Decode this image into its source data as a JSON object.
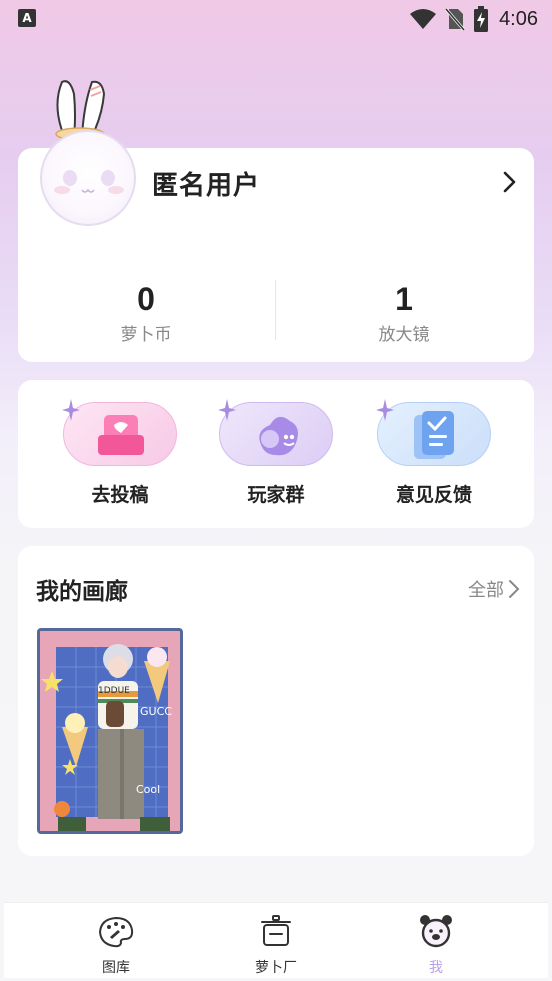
{
  "status_bar": {
    "app_icon_letter": "A",
    "time": "4:06"
  },
  "profile": {
    "username": "匿名用户",
    "stats": [
      {
        "value": "0",
        "label": "萝卜币"
      },
      {
        "value": "1",
        "label": "放大镜"
      }
    ]
  },
  "actions": [
    {
      "label": "去投稿",
      "icon": "submit-icon"
    },
    {
      "label": "玩家群",
      "icon": "player-group-icon"
    },
    {
      "label": "意见反馈",
      "icon": "feedback-icon"
    }
  ],
  "gallery": {
    "title": "我的画廊",
    "all_label": "全部",
    "artwork_texts": [
      "1DDUE",
      "GUCC",
      "Cool"
    ]
  },
  "tabbar": {
    "tabs": [
      {
        "label": "图库",
        "icon": "palette-icon",
        "active": false
      },
      {
        "label": "萝卜厂",
        "icon": "pot-icon",
        "active": false
      },
      {
        "label": "我",
        "icon": "bear-icon",
        "active": true
      }
    ],
    "active_color": "#b9a2e8"
  }
}
